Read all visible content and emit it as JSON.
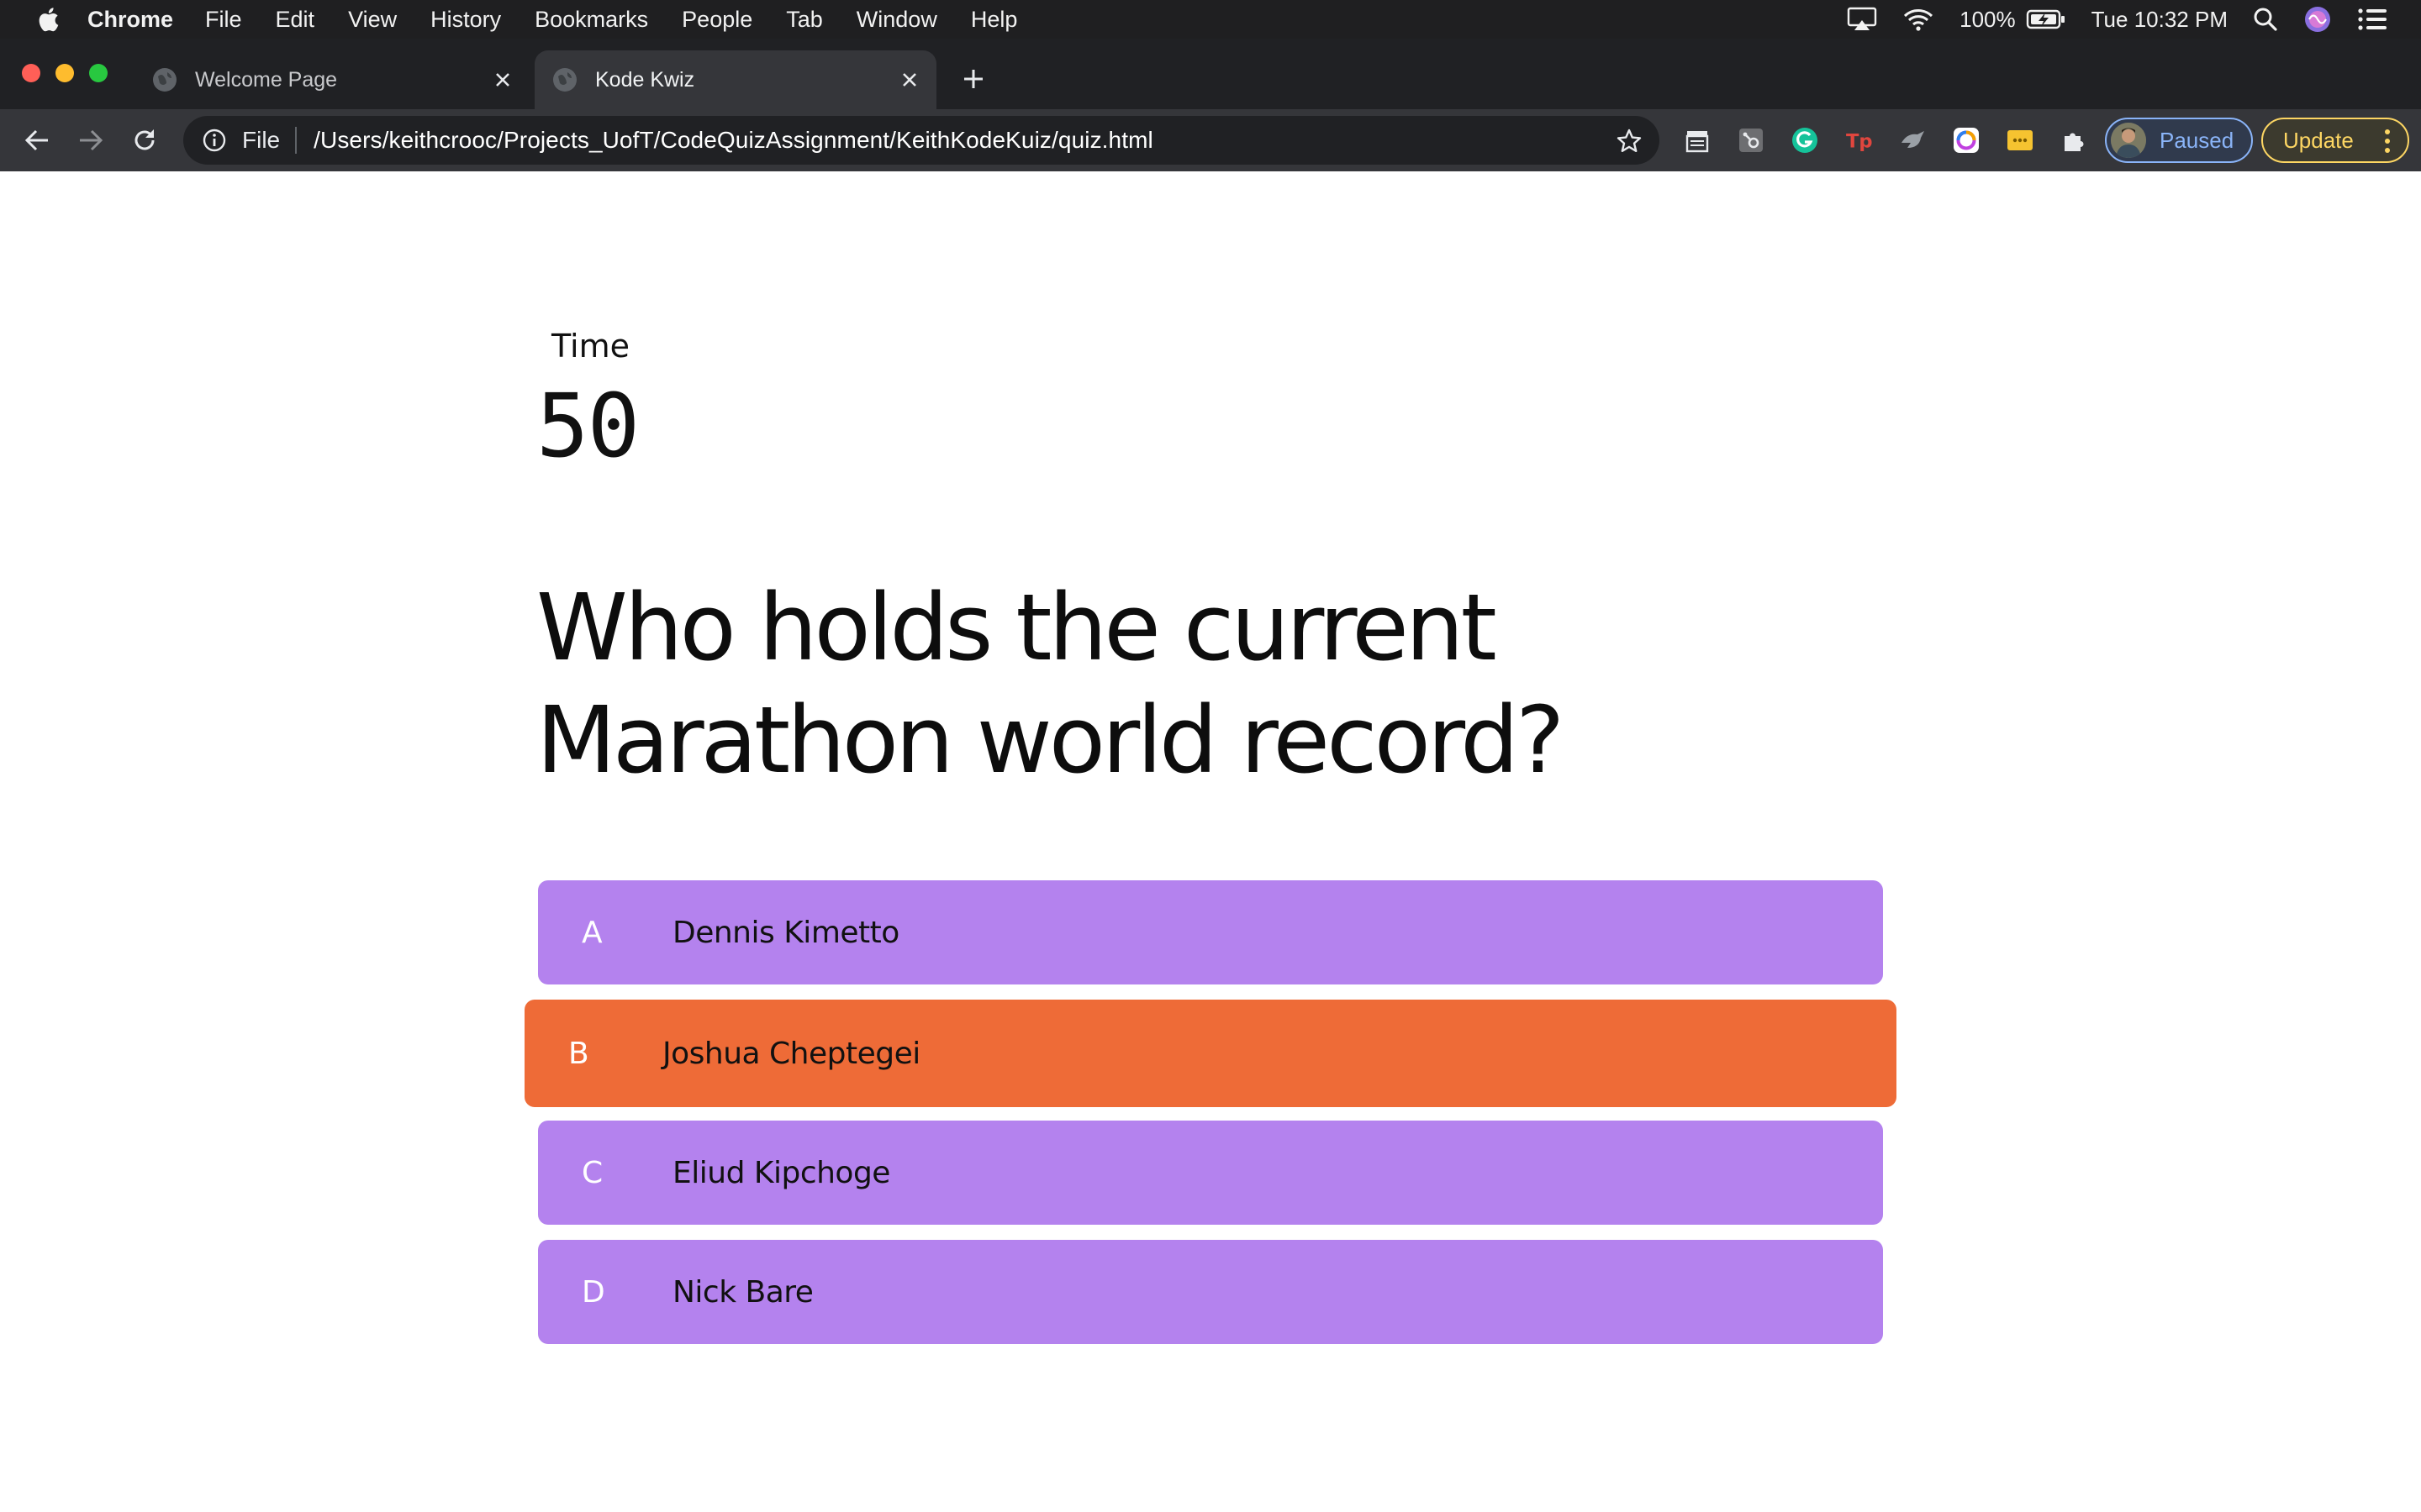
{
  "menubar": {
    "app_name": "Chrome",
    "items": [
      "File",
      "Edit",
      "View",
      "History",
      "Bookmarks",
      "People",
      "Tab",
      "Window",
      "Help"
    ],
    "battery": "100%",
    "clock": "Tue 10:32 PM",
    "icons": [
      "airplay-icon",
      "wifi-icon",
      "battery-icon",
      "spotlight-icon",
      "siri-icon",
      "control-center-icon"
    ]
  },
  "tabs": [
    {
      "title": "Welcome Page",
      "active": false
    },
    {
      "title": "Kode Kwiz",
      "active": true
    }
  ],
  "toolbar": {
    "scheme_label": "File",
    "url": "/Users/keithcrooc/Projects_UofT/CodeQuizAssignment/KeithKodeKuiz/quiz.html",
    "profile_label": "Paused",
    "update_label": "Update"
  },
  "quiz": {
    "timer_label": "Time",
    "timer_value": "50",
    "question": "Who holds the current Marathon world record?",
    "answers": [
      {
        "letter": "A",
        "text": "Dennis Kimetto",
        "color": "#b482ee"
      },
      {
        "letter": "B",
        "text": "Joshua Cheptegei",
        "color": "#ee6b37"
      },
      {
        "letter": "C",
        "text": "Eliud Kipchoge",
        "color": "#b482ee"
      },
      {
        "letter": "D",
        "text": "Nick Bare",
        "color": "#b482ee"
      }
    ]
  },
  "colors": {
    "menubar_bg": "#1f1f21",
    "tabstrip_bg": "#202124",
    "toolbar_bg": "#35363a",
    "answer_default": "#b482ee",
    "answer_hover": "#ee6b37"
  }
}
